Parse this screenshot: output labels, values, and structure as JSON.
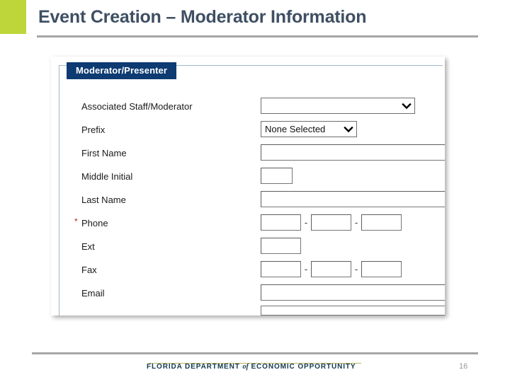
{
  "slide": {
    "title": "Event Creation – Moderator Information",
    "accent_green": "#bed639",
    "title_color": "#3f4f63",
    "rule_color": "#a6a6a6"
  },
  "panel": {
    "group_legend": "Moderator/Presenter",
    "legend_bg": "#0d3b72",
    "required_marker": "*",
    "required_color": "#b52a2a"
  },
  "form": {
    "rows": [
      {
        "label": "Associated Staff/Moderator",
        "required": false,
        "control": "select-wide",
        "value": ""
      },
      {
        "label": "Prefix",
        "required": false,
        "control": "select-small",
        "value": "None Selected"
      },
      {
        "label": "First Name",
        "required": false,
        "control": "text-wide",
        "value": ""
      },
      {
        "label": "Middle Initial",
        "required": false,
        "control": "text-tiny",
        "value": ""
      },
      {
        "label": "Last Name",
        "required": false,
        "control": "text-wide",
        "value": ""
      },
      {
        "label": "Phone",
        "required": true,
        "control": "text-triple",
        "value": "",
        "separator": "-"
      },
      {
        "label": "Ext",
        "required": false,
        "control": "text-tiny-wide",
        "value": ""
      },
      {
        "label": "Fax",
        "required": false,
        "control": "text-triple",
        "value": "",
        "separator": "-"
      },
      {
        "label": "Email",
        "required": false,
        "control": "text-wide",
        "value": ""
      }
    ],
    "dropdown_icon": "chevron-down-icon"
  },
  "footer": {
    "logo_pre": "FLORIDA DEPARTMENT ",
    "logo_of": "of",
    "logo_post": " ECONOMIC OPPORTUNITY",
    "page_number": "16",
    "logo_color": "#123a4f",
    "gold_rule": "#b9b46a"
  }
}
